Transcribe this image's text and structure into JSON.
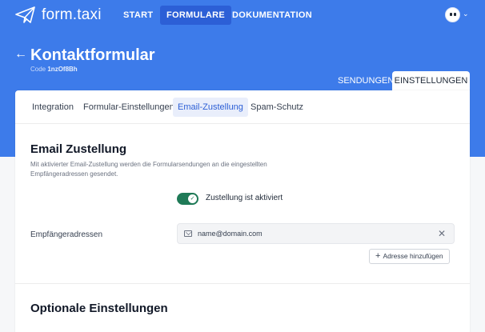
{
  "brand": {
    "name": "form.taxi",
    "icon": "paper-plane-icon"
  },
  "nav": {
    "items": [
      {
        "label": "START",
        "active": false
      },
      {
        "label": "FORMULARE",
        "active": true
      },
      {
        "label": "DOKUMENTATION",
        "active": false
      }
    ]
  },
  "header": {
    "title": "Kontaktformular",
    "code_label": "Code",
    "code_value": "1nzOf8Bh"
  },
  "tabs": [
    {
      "label": "SENDUNGEN",
      "active": false
    },
    {
      "label": "EINSTELLUNGEN",
      "active": true
    }
  ],
  "subtabs": [
    {
      "label": "Integration",
      "active": false
    },
    {
      "label": "Formular-Einstellungen",
      "active": false
    },
    {
      "label": "Email-Zustellung",
      "active": true
    },
    {
      "label": "Spam-Schutz",
      "active": false
    }
  ],
  "email_section": {
    "title": "Email Zustellung",
    "description": "Mit aktivierter Email-Zustellung werden die Formularsendungen an die eingestellten Empfängeradressen gesendet.",
    "toggle_label": "Zustellung ist aktiviert",
    "toggle_on": true,
    "recipients_label": "Empfängeradressen",
    "recipient_value": "name@domain.com",
    "add_button_label": "Adresse hinzufügen"
  },
  "optional_section": {
    "title": "Optionale Einstellungen"
  },
  "colors": {
    "header_blue": "#3d7bea",
    "nav_active": "#2c5fd6",
    "toggle_green": "#1f7a57"
  }
}
